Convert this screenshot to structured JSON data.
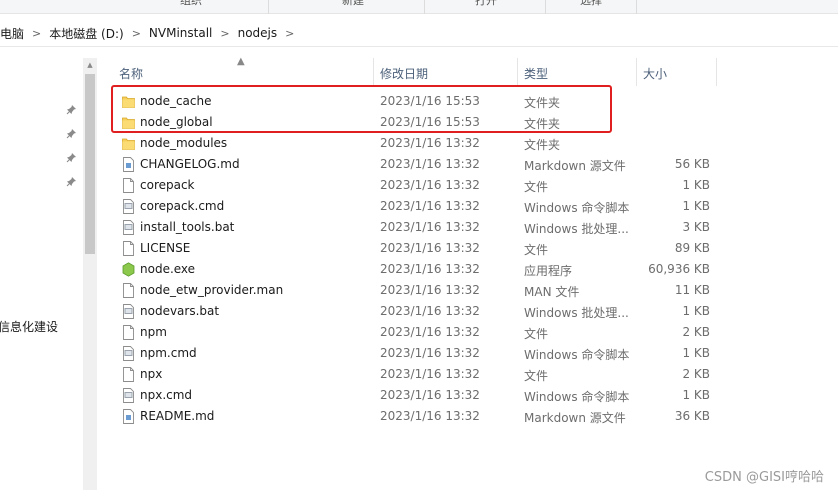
{
  "ribbon": {
    "groups": [
      "组织",
      "新建",
      "打开",
      "选择"
    ]
  },
  "address": {
    "crumbs": [
      "此电脑",
      "本地磁盘 (D:)",
      "NVMinstall",
      "nodejs"
    ],
    "dropdown_glyph": "⌄"
  },
  "nav": {
    "partial_label": "信息化建设"
  },
  "columns": {
    "name": "名称",
    "date": "修改日期",
    "type": "类型",
    "size": "大小"
  },
  "files": [
    {
      "name": "node_cache",
      "date": "2023/1/16 15:53",
      "type": "文件夹",
      "size": "",
      "icon": "folder-icon"
    },
    {
      "name": "node_global",
      "date": "2023/1/16 15:53",
      "type": "文件夹",
      "size": "",
      "icon": "folder-icon"
    },
    {
      "name": "node_modules",
      "date": "2023/1/16 13:32",
      "type": "文件夹",
      "size": "",
      "icon": "folder-icon"
    },
    {
      "name": "CHANGELOG.md",
      "date": "2023/1/16 13:32",
      "type": "Markdown 源文件",
      "size": "56 KB",
      "icon": "markdown-file-icon"
    },
    {
      "name": "corepack",
      "date": "2023/1/16 13:32",
      "type": "文件",
      "size": "1 KB",
      "icon": "file-icon"
    },
    {
      "name": "corepack.cmd",
      "date": "2023/1/16 13:32",
      "type": "Windows 命令脚本",
      "size": "1 KB",
      "icon": "script-icon"
    },
    {
      "name": "install_tools.bat",
      "date": "2023/1/16 13:32",
      "type": "Windows 批处理...",
      "size": "3 KB",
      "icon": "script-icon"
    },
    {
      "name": "LICENSE",
      "date": "2023/1/16 13:32",
      "type": "文件",
      "size": "89 KB",
      "icon": "file-icon"
    },
    {
      "name": "node.exe",
      "date": "2023/1/16 13:32",
      "type": "应用程序",
      "size": "60,936 KB",
      "icon": "node-exe-icon"
    },
    {
      "name": "node_etw_provider.man",
      "date": "2023/1/16 13:32",
      "type": "MAN 文件",
      "size": "11 KB",
      "icon": "file-icon"
    },
    {
      "name": "nodevars.bat",
      "date": "2023/1/16 13:32",
      "type": "Windows 批处理...",
      "size": "1 KB",
      "icon": "script-icon"
    },
    {
      "name": "npm",
      "date": "2023/1/16 13:32",
      "type": "文件",
      "size": "2 KB",
      "icon": "file-icon"
    },
    {
      "name": "npm.cmd",
      "date": "2023/1/16 13:32",
      "type": "Windows 命令脚本",
      "size": "1 KB",
      "icon": "script-icon"
    },
    {
      "name": "npx",
      "date": "2023/1/16 13:32",
      "type": "文件",
      "size": "2 KB",
      "icon": "file-icon"
    },
    {
      "name": "npx.cmd",
      "date": "2023/1/16 13:32",
      "type": "Windows 命令脚本",
      "size": "1 KB",
      "icon": "script-icon"
    },
    {
      "name": "README.md",
      "date": "2023/1/16 13:32",
      "type": "Markdown 源文件",
      "size": "36 KB",
      "icon": "markdown-file-icon"
    }
  ],
  "highlight": {
    "color": "#e02020",
    "rows": [
      "node_cache",
      "node_global"
    ]
  },
  "watermark": "CSDN @GISI哼哈哈"
}
